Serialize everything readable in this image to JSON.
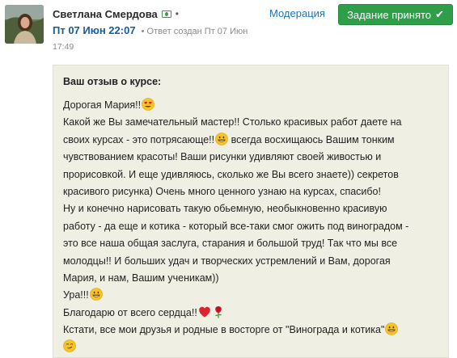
{
  "author": {
    "name": "Светлана Смердова",
    "badge_icon": "money-icon",
    "separator": "•"
  },
  "post": {
    "date": "Пт 07 Июн 22:07",
    "separator": "•",
    "answer_created": "Ответ создан Пт 07 Июн",
    "time": "17:49"
  },
  "actions": {
    "moderation_label": "Модерация",
    "accept_label": "Задание принято",
    "accept_icon": "check-icon",
    "accept_color": "#2e9e48"
  },
  "review": {
    "title": "Ваш отзыв о курсе:",
    "background": "#efefe3",
    "lines": [
      "Дорогая Мария!!",
      "Какой же Вы замечательный мастер!! Столько красивых работ даете на",
      "своих курсах - это потрясающе!!",
      " всегда восхищаюсь Вашим тонким",
      "чувствованием красоты! Ваши рисунки удивляют своей живостью и",
      "прорисовкой. И еще удивляюсь, сколько же Вы всего знаете)) секретов",
      "красивого рисунка) Очень много ценного узнаю на курсах, спасибо!",
      "Ну и конечно нарисовать такую обьемную, необыкновенно красивую",
      "работу - да еще и котика - который все-таки смог ожить под виноградом -",
      "это все наша общая заслуга, старания и большой труд! Так что мы все",
      "молодцы!! И больших удач и творческих устремлений и Вам, дорогая",
      "Мария, и нам, Вашим ученикам))",
      "Ура!!!",
      "Благодарю от всего сердца!!",
      "Кстати, все мои друзья и родные в восторге от \"Винограда и котика\""
    ],
    "emoji_names": [
      "heart-eyes-emoji",
      "grin-emoji",
      "heart-emoji",
      "rose-emoji",
      "smirk-emoji"
    ]
  }
}
